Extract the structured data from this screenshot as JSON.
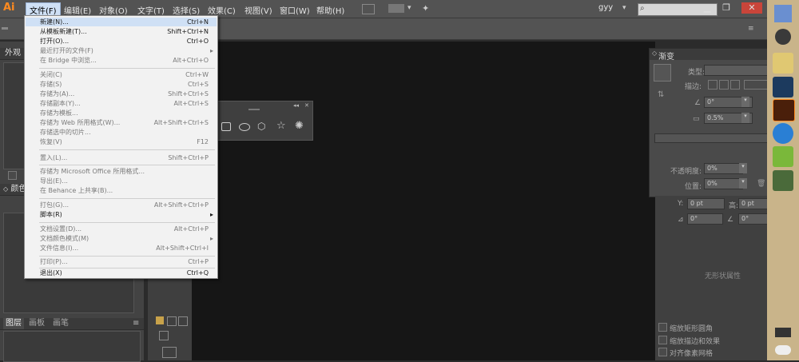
{
  "app": {
    "logo": "Ai",
    "user": "gyy"
  },
  "menubar": {
    "items": [
      {
        "label": "文件(F)"
      },
      {
        "label": "编辑(E)"
      },
      {
        "label": "对象(O)"
      },
      {
        "label": "文字(T)"
      },
      {
        "label": "选择(S)"
      },
      {
        "label": "效果(C)"
      },
      {
        "label": "视图(V)"
      },
      {
        "label": "窗口(W)"
      },
      {
        "label": "帮助(H)"
      }
    ]
  },
  "window_controls": {
    "minimize": "▁",
    "restore": "❐",
    "close": "✕"
  },
  "file_menu": {
    "items": [
      {
        "label": "新建(N)...",
        "shortcut": "Ctrl+N"
      },
      {
        "label": "从模板新建(T)...",
        "shortcut": "Shift+Ctrl+N"
      },
      {
        "label": "打开(O)...",
        "shortcut": "Ctrl+O"
      },
      {
        "label": "最近打开的文件(F)",
        "shortcut": ""
      },
      {
        "label": "在 Bridge 中浏览...",
        "shortcut": "Alt+Ctrl+O"
      },
      {
        "label": "关闭(C)",
        "shortcut": "Ctrl+W"
      },
      {
        "label": "存储(S)",
        "shortcut": "Ctrl+S"
      },
      {
        "label": "存储为(A)...",
        "shortcut": "Shift+Ctrl+S"
      },
      {
        "label": "存储副本(Y)...",
        "shortcut": "Alt+Ctrl+S"
      },
      {
        "label": "存储为模板...",
        "shortcut": ""
      },
      {
        "label": "存储为 Web 所用格式(W)...",
        "shortcut": "Alt+Shift+Ctrl+S"
      },
      {
        "label": "存储选中的切片...",
        "shortcut": ""
      },
      {
        "label": "恢复(V)",
        "shortcut": "F12"
      },
      {
        "label": "置入(L)...",
        "shortcut": "Shift+Ctrl+P"
      },
      {
        "label": "存储为 Microsoft Office 所用格式...",
        "shortcut": ""
      },
      {
        "label": "导出(E)...",
        "shortcut": ""
      },
      {
        "label": "在 Behance 上共享(B)...",
        "shortcut": ""
      },
      {
        "label": "打包(G)...",
        "shortcut": "Alt+Shift+Ctrl+P"
      },
      {
        "label": "脚本(R)",
        "shortcut": ""
      },
      {
        "label": "文档设置(D)...",
        "shortcut": "Alt+Ctrl+P"
      },
      {
        "label": "文档颜色模式(M)",
        "shortcut": ""
      },
      {
        "label": "文件信息(I)...",
        "shortcut": "Alt+Shift+Ctrl+I"
      },
      {
        "label": "打印(P)...",
        "shortcut": "Ctrl+P"
      },
      {
        "label": "退出(X)",
        "shortcut": "Ctrl+Q"
      }
    ]
  },
  "left_panels": {
    "appearance": "外观",
    "color": "颜色",
    "tabs": [
      "图层",
      "画板",
      "画笔"
    ]
  },
  "gradient_panel": {
    "title": "渐变",
    "type_label": "类型:",
    "stroke_label": "描边:",
    "angle_value": "0°",
    "ratio_value": "0.5%",
    "opacity_label": "不透明度:",
    "opacity_value": "0%",
    "location_label": "位置:",
    "location_value": "0%"
  },
  "transform_panel": {
    "y_label": "Y:",
    "y_value": "0 pt",
    "h_label": "高:",
    "h_value": "0 pt",
    "angle1": "0°",
    "angle2": "0°",
    "no_shape": "无形状属性",
    "options": [
      "缩放矩形圆角",
      "缩放描边和效果",
      "对齐像素网格"
    ]
  }
}
